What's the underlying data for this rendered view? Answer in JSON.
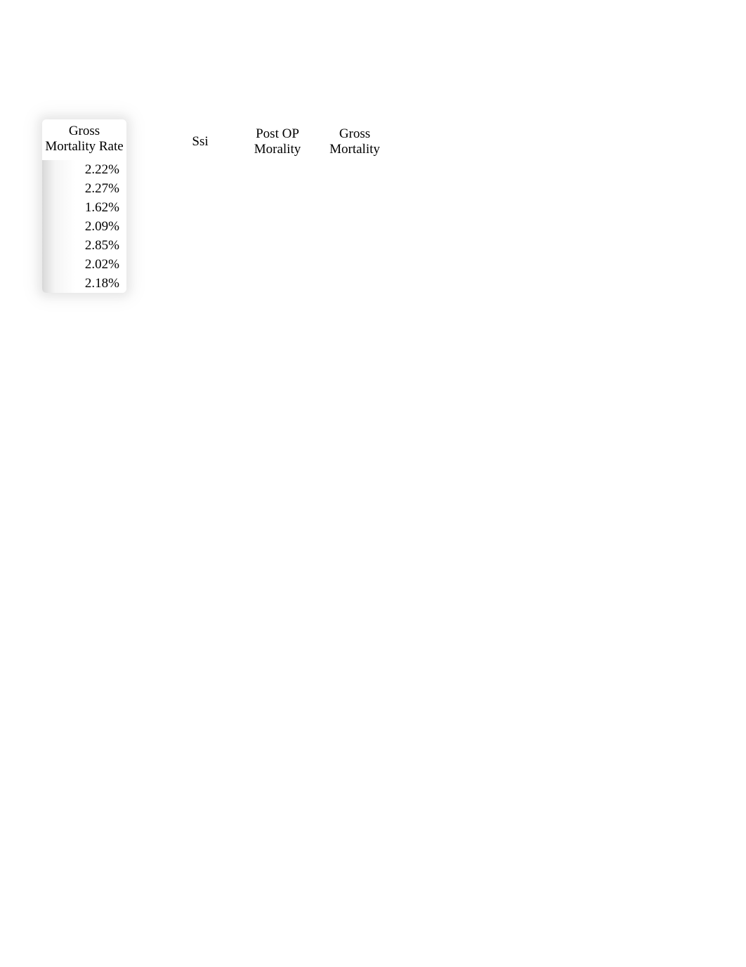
{
  "table": {
    "header": "Gross Mortality Rate",
    "rows": [
      "2.22%",
      "2.27%",
      "1.62%",
      "2.09%",
      "2.85%",
      "2.02%",
      "2.18%"
    ]
  },
  "columns": {
    "ssi": "Ssi",
    "post_op": "Post OP Morality",
    "gross": "Gross Mortality"
  }
}
